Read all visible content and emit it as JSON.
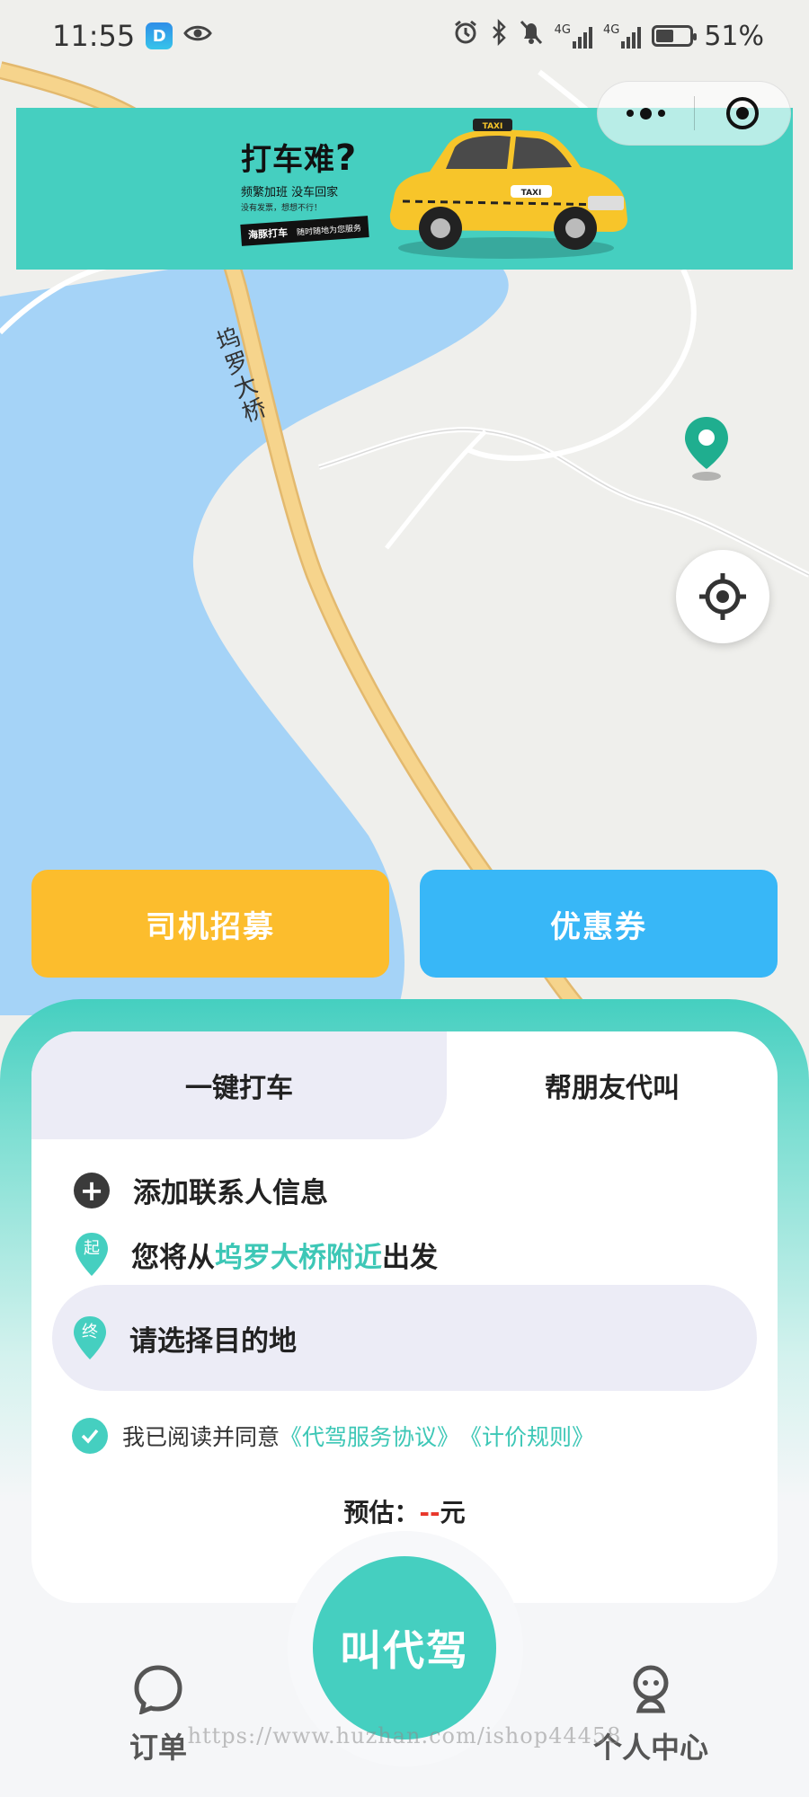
{
  "status_bar": {
    "time": "11:55",
    "app_icon_text": "D",
    "battery_percent": "51%",
    "battery_level": 0.51,
    "net1": "4G",
    "net2": "4G"
  },
  "capsule": {
    "more_icon": "more-dots-icon",
    "close_icon": "target-ring-icon"
  },
  "banner": {
    "title": "打车难",
    "subtitle": "频繁加班  没车回家",
    "subtitle2": "没有发票，想想不行！",
    "tag": "海豚打车",
    "tag_sub": "随时随地为您服务",
    "taxi_sign": "TAXI"
  },
  "map": {
    "road_label": "坞罗大桥",
    "pin_icon": "location-pin-icon",
    "locate_icon": "crosshair-icon"
  },
  "actions": {
    "driver_recruit": "司机招募",
    "coupon": "优惠券"
  },
  "tabs": {
    "one_tap": "一键打车",
    "for_friend": "帮朋友代叫",
    "active": "for_friend"
  },
  "form": {
    "add_contact": "添加联系人信息",
    "start_badge": "起",
    "start_prefix": "您将从",
    "start_place": "坞罗大桥附近",
    "start_suffix": "出发",
    "end_badge": "终",
    "destination_placeholder": "请选择目的地"
  },
  "agreement": {
    "prefix": "我已阅读并同意",
    "link_service": "《代驾服务协议》",
    "link_pricing": "《计价规则》",
    "checked": true
  },
  "estimate": {
    "label": "预估：",
    "value": "--",
    "unit": "元"
  },
  "nav": {
    "orders": "订单",
    "call": "叫代驾",
    "profile": "个人中心"
  },
  "watermark": "https://www.huzhan.com/ishop44458",
  "colors": {
    "brand_teal": "#45cfc0",
    "recruit_yellow": "#fcbd2d",
    "coupon_blue": "#38b7f7",
    "water": "#a5d3f7",
    "road": "#f6d48c",
    "price_red": "#e8372b"
  }
}
